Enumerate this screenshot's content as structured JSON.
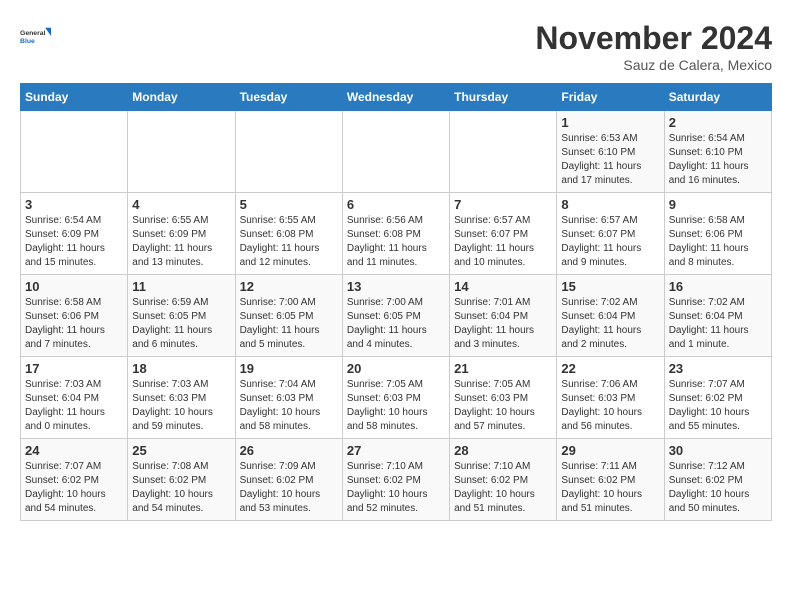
{
  "header": {
    "logo_line1": "General",
    "logo_line2": "Blue",
    "month": "November 2024",
    "location": "Sauz de Calera, Mexico"
  },
  "weekdays": [
    "Sunday",
    "Monday",
    "Tuesday",
    "Wednesday",
    "Thursday",
    "Friday",
    "Saturday"
  ],
  "weeks": [
    [
      {
        "day": "",
        "info": ""
      },
      {
        "day": "",
        "info": ""
      },
      {
        "day": "",
        "info": ""
      },
      {
        "day": "",
        "info": ""
      },
      {
        "day": "",
        "info": ""
      },
      {
        "day": "1",
        "info": "Sunrise: 6:53 AM\nSunset: 6:10 PM\nDaylight: 11 hours and 17 minutes."
      },
      {
        "day": "2",
        "info": "Sunrise: 6:54 AM\nSunset: 6:10 PM\nDaylight: 11 hours and 16 minutes."
      }
    ],
    [
      {
        "day": "3",
        "info": "Sunrise: 6:54 AM\nSunset: 6:09 PM\nDaylight: 11 hours and 15 minutes."
      },
      {
        "day": "4",
        "info": "Sunrise: 6:55 AM\nSunset: 6:09 PM\nDaylight: 11 hours and 13 minutes."
      },
      {
        "day": "5",
        "info": "Sunrise: 6:55 AM\nSunset: 6:08 PM\nDaylight: 11 hours and 12 minutes."
      },
      {
        "day": "6",
        "info": "Sunrise: 6:56 AM\nSunset: 6:08 PM\nDaylight: 11 hours and 11 minutes."
      },
      {
        "day": "7",
        "info": "Sunrise: 6:57 AM\nSunset: 6:07 PM\nDaylight: 11 hours and 10 minutes."
      },
      {
        "day": "8",
        "info": "Sunrise: 6:57 AM\nSunset: 6:07 PM\nDaylight: 11 hours and 9 minutes."
      },
      {
        "day": "9",
        "info": "Sunrise: 6:58 AM\nSunset: 6:06 PM\nDaylight: 11 hours and 8 minutes."
      }
    ],
    [
      {
        "day": "10",
        "info": "Sunrise: 6:58 AM\nSunset: 6:06 PM\nDaylight: 11 hours and 7 minutes."
      },
      {
        "day": "11",
        "info": "Sunrise: 6:59 AM\nSunset: 6:05 PM\nDaylight: 11 hours and 6 minutes."
      },
      {
        "day": "12",
        "info": "Sunrise: 7:00 AM\nSunset: 6:05 PM\nDaylight: 11 hours and 5 minutes."
      },
      {
        "day": "13",
        "info": "Sunrise: 7:00 AM\nSunset: 6:05 PM\nDaylight: 11 hours and 4 minutes."
      },
      {
        "day": "14",
        "info": "Sunrise: 7:01 AM\nSunset: 6:04 PM\nDaylight: 11 hours and 3 minutes."
      },
      {
        "day": "15",
        "info": "Sunrise: 7:02 AM\nSunset: 6:04 PM\nDaylight: 11 hours and 2 minutes."
      },
      {
        "day": "16",
        "info": "Sunrise: 7:02 AM\nSunset: 6:04 PM\nDaylight: 11 hours and 1 minute."
      }
    ],
    [
      {
        "day": "17",
        "info": "Sunrise: 7:03 AM\nSunset: 6:04 PM\nDaylight: 11 hours and 0 minutes."
      },
      {
        "day": "18",
        "info": "Sunrise: 7:03 AM\nSunset: 6:03 PM\nDaylight: 10 hours and 59 minutes."
      },
      {
        "day": "19",
        "info": "Sunrise: 7:04 AM\nSunset: 6:03 PM\nDaylight: 10 hours and 58 minutes."
      },
      {
        "day": "20",
        "info": "Sunrise: 7:05 AM\nSunset: 6:03 PM\nDaylight: 10 hours and 58 minutes."
      },
      {
        "day": "21",
        "info": "Sunrise: 7:05 AM\nSunset: 6:03 PM\nDaylight: 10 hours and 57 minutes."
      },
      {
        "day": "22",
        "info": "Sunrise: 7:06 AM\nSunset: 6:03 PM\nDaylight: 10 hours and 56 minutes."
      },
      {
        "day": "23",
        "info": "Sunrise: 7:07 AM\nSunset: 6:02 PM\nDaylight: 10 hours and 55 minutes."
      }
    ],
    [
      {
        "day": "24",
        "info": "Sunrise: 7:07 AM\nSunset: 6:02 PM\nDaylight: 10 hours and 54 minutes."
      },
      {
        "day": "25",
        "info": "Sunrise: 7:08 AM\nSunset: 6:02 PM\nDaylight: 10 hours and 54 minutes."
      },
      {
        "day": "26",
        "info": "Sunrise: 7:09 AM\nSunset: 6:02 PM\nDaylight: 10 hours and 53 minutes."
      },
      {
        "day": "27",
        "info": "Sunrise: 7:10 AM\nSunset: 6:02 PM\nDaylight: 10 hours and 52 minutes."
      },
      {
        "day": "28",
        "info": "Sunrise: 7:10 AM\nSunset: 6:02 PM\nDaylight: 10 hours and 51 minutes."
      },
      {
        "day": "29",
        "info": "Sunrise: 7:11 AM\nSunset: 6:02 PM\nDaylight: 10 hours and 51 minutes."
      },
      {
        "day": "30",
        "info": "Sunrise: 7:12 AM\nSunset: 6:02 PM\nDaylight: 10 hours and 50 minutes."
      }
    ]
  ]
}
